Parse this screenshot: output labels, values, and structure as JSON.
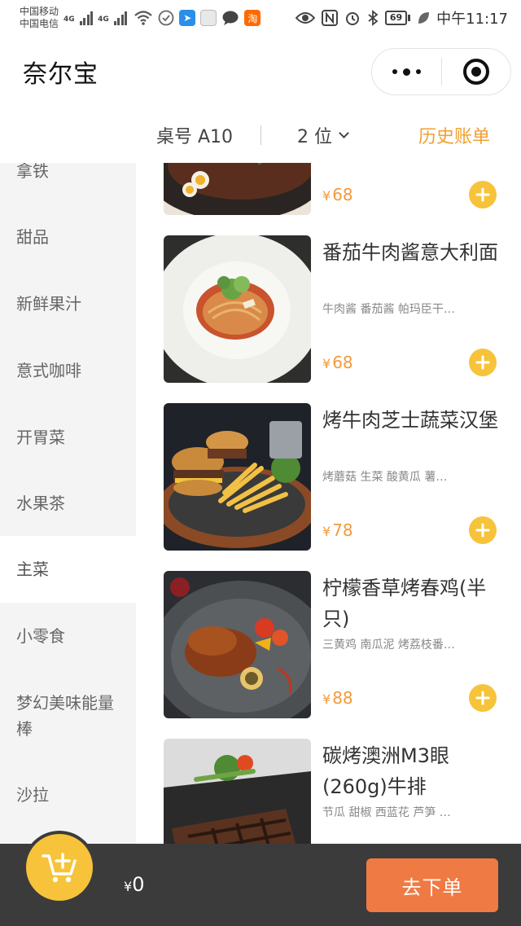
{
  "status_bar": {
    "carrier1": "中国移动",
    "carrier2": "中国电信",
    "net1": "4G",
    "net2": "4G",
    "battery": "69",
    "time": "中午11:17"
  },
  "header": {
    "title": "奈尔宝"
  },
  "table_bar": {
    "table_no": "桌号 A10",
    "guests": "2 位",
    "history": "历史账单"
  },
  "categories": [
    {
      "label": "拿铁"
    },
    {
      "label": "甜品"
    },
    {
      "label": "新鲜果汁"
    },
    {
      "label": "意式咖啡"
    },
    {
      "label": "开胃菜"
    },
    {
      "label": "水果茶"
    },
    {
      "label": "主菜",
      "active": true
    },
    {
      "label": "小零食"
    },
    {
      "label": "梦幻美味能量棒"
    },
    {
      "label": "沙拉"
    }
  ],
  "dishes": [
    {
      "name": "",
      "desc": "",
      "currency": "¥",
      "price": "68",
      "image": "dish-eggs-skillet"
    },
    {
      "name": "番茄牛肉酱意大利面",
      "desc": "牛肉酱 番茄酱 帕玛臣干…",
      "currency": "¥",
      "price": "68",
      "image": "dish-spaghetti"
    },
    {
      "name": "烤牛肉芝士蔬菜汉堡",
      "desc": "烤蘑菇 生菜 酸黄瓜 薯…",
      "currency": "¥",
      "price": "78",
      "image": "dish-burger"
    },
    {
      "name": "柠檬香草烤春鸡(半只)",
      "desc": "三黄鸡 南瓜泥 烤荔枝番…",
      "currency": "¥",
      "price": "88",
      "image": "dish-roast-chicken"
    },
    {
      "name": "碳烤澳洲M3眼(260g)牛排",
      "desc": "节瓜 甜椒 西蓝花 芦笋 …",
      "currency": "¥",
      "price": "",
      "image": "dish-steak"
    }
  ],
  "footer": {
    "currency": "¥",
    "total": "0",
    "order_label": "去下单"
  },
  "colors": {
    "accent_orange": "#f39a3c",
    "add_yellow": "#f6c33a",
    "order_button": "#f07a43",
    "footer_bg": "#3b3b3b"
  }
}
